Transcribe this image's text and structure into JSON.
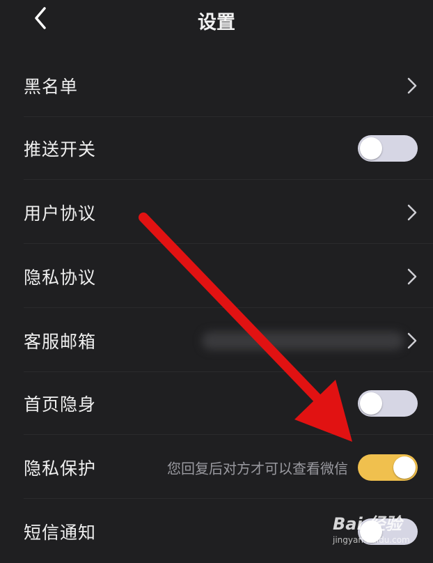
{
  "header": {
    "title": "设置"
  },
  "rows": [
    {
      "label": "黑名单",
      "control": "chevron"
    },
    {
      "label": "推送开关",
      "control": "toggle",
      "state": "off"
    },
    {
      "label": "用户协议",
      "control": "chevron"
    },
    {
      "label": "隐私协议",
      "control": "chevron"
    },
    {
      "label": "客服邮箱",
      "control": "chevron",
      "value": "blurred"
    },
    {
      "label": "首页隐身",
      "control": "toggle",
      "state": "off"
    },
    {
      "label": "隐私保护",
      "control": "toggle",
      "state": "on",
      "note": "您回复后对方才可以查看微信"
    },
    {
      "label": "短信通知",
      "control": "toggle",
      "state": "off"
    }
  ],
  "watermark": {
    "brand": "Bai 经验",
    "url": "jingyan.baidu.com"
  },
  "colors": {
    "background": "#1f1f21",
    "toggle_on": "#f0c04e",
    "toggle_off": "#d6d6e4",
    "arrow": "#e11212"
  }
}
